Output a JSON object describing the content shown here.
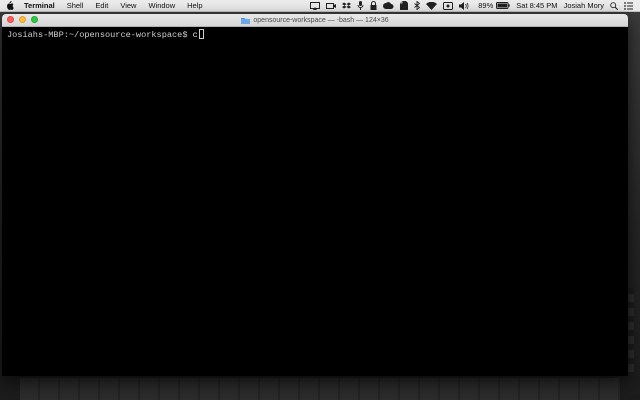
{
  "menubar": {
    "app_name": "Terminal",
    "menus": [
      "Shell",
      "Edit",
      "View",
      "Window",
      "Help"
    ],
    "status": {
      "battery_percent": "89%",
      "clock": "Sat 8:45 PM",
      "user": "Josiah Mory"
    },
    "icons": [
      "apple-icon",
      "airplay-icon",
      "camera-icon",
      "dropbox-icon",
      "mic-icon",
      "lock-icon",
      "cloud-icon",
      "evernote-icon",
      "bluetooth-icon",
      "wifi-icon",
      "display-icon",
      "volume-icon",
      "battery-icon",
      "spotlight-icon",
      "notification-center-icon"
    ]
  },
  "window": {
    "title": "opensource-workspace — -bash — 124×36",
    "prompt": "Josiahs-MBP:~/opensource-workspace$",
    "command": "c"
  },
  "colors": {
    "terminal_bg": "#000000",
    "menubar_bg": "#ededed",
    "close": "#fc605c",
    "minimize": "#fdbc40",
    "zoom": "#34c84a"
  }
}
